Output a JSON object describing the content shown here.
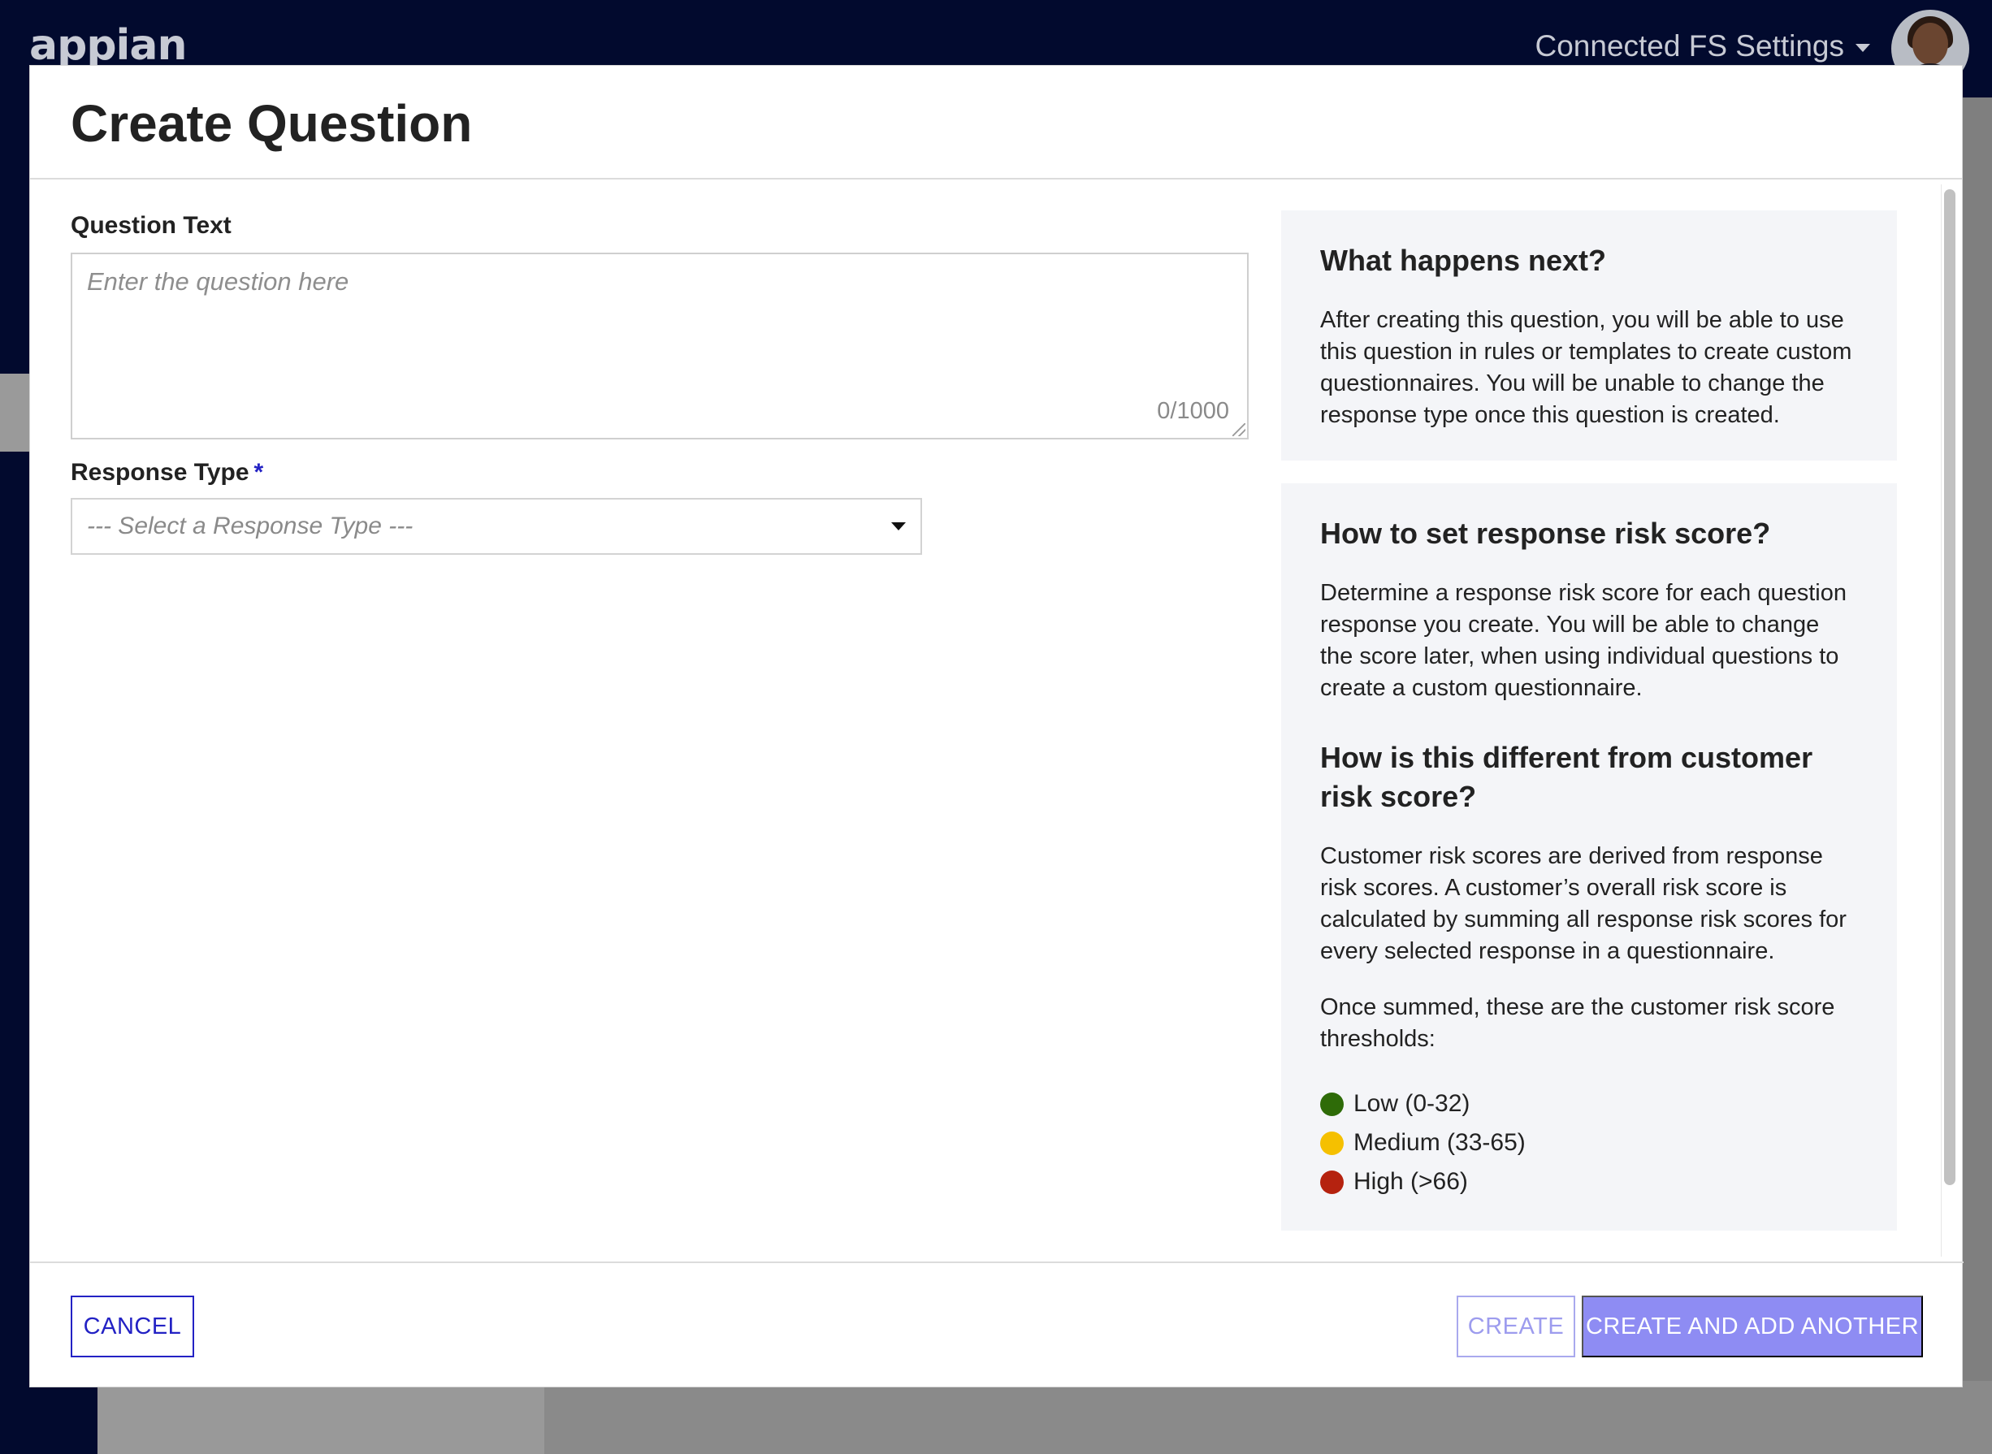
{
  "app": {
    "logo_text": "appian",
    "settings_menu_label": "Connected FS Settings"
  },
  "modal": {
    "title": "Create Question",
    "question_field": {
      "label": "Question Text",
      "placeholder": "Enter the question here",
      "value": "",
      "char_count": "0/1000"
    },
    "response_type_field": {
      "label": "Response Type",
      "required_marker": "*",
      "selected": "--- Select a Response Type ---"
    },
    "info_next": {
      "heading": "What happens next?",
      "text": "After creating this question, you will be able to use this question in rules or templates to create custom questionnaires. You will be unable to change the response type once this question is created."
    },
    "info_risk": {
      "heading": "How to set response risk score?",
      "text": "Determine a response risk score for each question response you create. You will be able to change the score later, when using individual questions to create a custom questionnaire.",
      "heading2": "How is this different from customer risk score?",
      "text2": "Customer risk scores are derived from response risk scores. A customer’s overall risk score is calculated by summing all response risk scores for every selected response in a questionnaire.",
      "text3": "Once summed, these are the customer risk score thresholds:",
      "thresholds": [
        {
          "label": "Low (0-32)",
          "color": "#2e6b08"
        },
        {
          "label": "Medium (33-65)",
          "color": "#f5c000"
        },
        {
          "label": "High (>66)",
          "color": "#b5220f"
        }
      ]
    },
    "buttons": {
      "cancel": "CANCEL",
      "create": "CREATE",
      "create_another": "CREATE AND ADD ANOTHER"
    }
  }
}
